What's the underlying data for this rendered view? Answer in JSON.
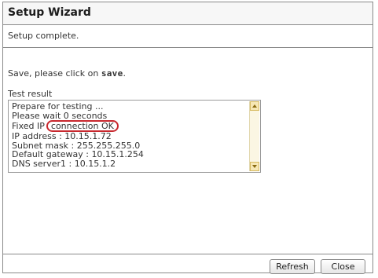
{
  "window": {
    "title": "Setup Wizard",
    "subtitle": "Setup complete."
  },
  "instruction": {
    "prefix": "Save, please click on ",
    "keyword": "save",
    "suffix": "."
  },
  "result": {
    "label": "Test result",
    "lines": [
      "Prepare for testing ...",
      "Please wait 0 seconds",
      "Fixed IP",
      "IP address : 10.15.1.72",
      "Subnet mask : 255.255.255.0",
      "Default gateway  : 10.15.1.254",
      "DNS server1 : 10.15.1.2"
    ],
    "highlight": "connection OK"
  },
  "buttons": {
    "refresh": "Refresh",
    "close": "Close"
  },
  "colors": {
    "highlight_ring": "#c8282e",
    "scrollbar": "#f6e7b5"
  }
}
